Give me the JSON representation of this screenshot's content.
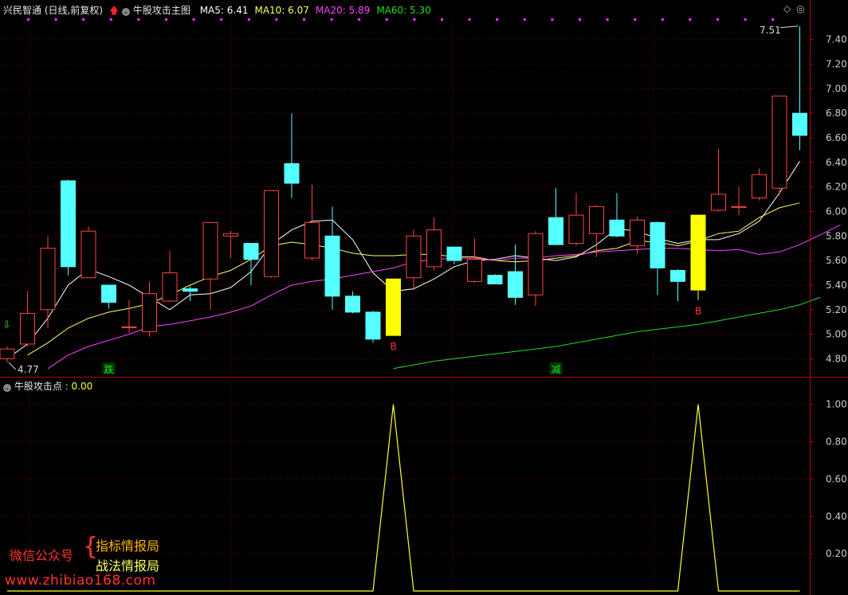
{
  "header": {
    "stock": "兴民智通",
    "period": "(日线,前复权)",
    "indicator": "牛股攻击主图",
    "ma": [
      {
        "label": "MA5:",
        "value": "6.41",
        "color": "#ffffff"
      },
      {
        "label": "MA10:",
        "value": "6.07",
        "color": "#ffff66"
      },
      {
        "label": "MA20:",
        "value": "5.89",
        "color": "#ff44ff"
      },
      {
        "label": "MA60:",
        "value": "5.30",
        "color": "#22dd22"
      }
    ]
  },
  "sub_header": {
    "label": "牛股攻击点",
    "value": ": 0.00"
  },
  "annotations": {
    "high_label": "7.51",
    "low_label": "4.77",
    "buy_label": "B",
    "mark_die": "跌",
    "mark_jian": "减"
  },
  "watermark": {
    "left": "微信公众号",
    "line1": "指标情报局",
    "line2": "战法情报局",
    "url": "www.zhibiao168.com"
  },
  "colors": {
    "up": "#ff4444",
    "down": "#55ffff",
    "signal": "#ffff00",
    "grid": "#8b0000",
    "axis_text": "#cccccc"
  },
  "chart_data": [
    {
      "type": "candlestick",
      "title": "牛股攻击主图",
      "ylim": [
        4.66,
        7.58
      ],
      "y_ticks": [
        4.8,
        5.0,
        5.2,
        5.4,
        5.6,
        5.8,
        6.0,
        6.2,
        6.4,
        6.6,
        6.8,
        7.0,
        7.2,
        7.4
      ],
      "candles": [
        {
          "o": 4.8,
          "h": 4.9,
          "l": 4.77,
          "c": 4.88
        },
        {
          "o": 4.92,
          "h": 5.35,
          "l": 4.9,
          "c": 5.17
        },
        {
          "o": 5.2,
          "h": 5.8,
          "l": 5.05,
          "c": 5.7
        },
        {
          "o": 6.25,
          "h": 6.26,
          "l": 5.48,
          "c": 5.55
        },
        {
          "o": 5.46,
          "h": 5.88,
          "l": 5.46,
          "c": 5.84
        },
        {
          "o": 5.4,
          "h": 5.4,
          "l": 5.21,
          "c": 5.26
        },
        {
          "o": 5.06,
          "h": 5.28,
          "l": 5.01,
          "c": 5.06
        },
        {
          "o": 5.02,
          "h": 5.43,
          "l": 4.98,
          "c": 5.33
        },
        {
          "o": 5.27,
          "h": 5.68,
          "l": 5.26,
          "c": 5.5
        },
        {
          "o": 5.37,
          "h": 5.39,
          "l": 5.27,
          "c": 5.35
        },
        {
          "o": 5.45,
          "h": 5.91,
          "l": 5.2,
          "c": 5.91
        },
        {
          "o": 5.8,
          "h": 5.84,
          "l": 5.62,
          "c": 5.82
        },
        {
          "o": 5.74,
          "h": 5.74,
          "l": 5.4,
          "c": 5.61
        },
        {
          "o": 5.47,
          "h": 6.17,
          "l": 5.46,
          "c": 6.17
        },
        {
          "o": 6.39,
          "h": 6.8,
          "l": 6.11,
          "c": 6.23
        },
        {
          "o": 5.62,
          "h": 6.22,
          "l": 5.6,
          "c": 5.91
        },
        {
          "o": 5.8,
          "h": 6.04,
          "l": 5.2,
          "c": 5.31
        },
        {
          "o": 5.31,
          "h": 5.35,
          "l": 5.17,
          "c": 5.18
        },
        {
          "o": 5.18,
          "h": 5.19,
          "l": 4.93,
          "c": 4.96
        },
        {
          "o": 4.99,
          "h": 5.45,
          "l": 4.99,
          "c": 5.45
        },
        {
          "o": 5.46,
          "h": 5.85,
          "l": 5.36,
          "c": 5.8
        },
        {
          "o": 5.55,
          "h": 5.95,
          "l": 5.52,
          "c": 5.85
        },
        {
          "o": 5.71,
          "h": 5.71,
          "l": 5.57,
          "c": 5.6
        },
        {
          "o": 5.43,
          "h": 5.78,
          "l": 5.42,
          "c": 5.61
        },
        {
          "o": 5.48,
          "h": 5.49,
          "l": 5.41,
          "c": 5.41
        },
        {
          "o": 5.51,
          "h": 5.73,
          "l": 5.24,
          "c": 5.3
        },
        {
          "o": 5.32,
          "h": 5.84,
          "l": 5.23,
          "c": 5.82
        },
        {
          "o": 5.95,
          "h": 6.19,
          "l": 5.73,
          "c": 5.73
        },
        {
          "o": 5.74,
          "h": 6.15,
          "l": 5.72,
          "c": 5.97
        },
        {
          "o": 5.82,
          "h": 6.05,
          "l": 5.63,
          "c": 6.04
        },
        {
          "o": 5.93,
          "h": 6.15,
          "l": 5.79,
          "c": 5.8
        },
        {
          "o": 5.72,
          "h": 5.96,
          "l": 5.65,
          "c": 5.93
        },
        {
          "o": 5.91,
          "h": 5.92,
          "l": 5.32,
          "c": 5.54
        },
        {
          "o": 5.52,
          "h": 5.53,
          "l": 5.27,
          "c": 5.43
        },
        {
          "o": 5.97,
          "h": 5.97,
          "l": 5.28,
          "c": 5.36
        },
        {
          "o": 6.01,
          "h": 6.51,
          "l": 6.0,
          "c": 6.14
        },
        {
          "o": 6.04,
          "h": 6.2,
          "l": 5.97,
          "c": 6.04
        },
        {
          "o": 6.11,
          "h": 6.35,
          "l": 6.09,
          "c": 6.3
        },
        {
          "o": 6.19,
          "h": 6.94,
          "l": 6.13,
          "c": 6.94
        },
        {
          "o": 6.8,
          "h": 7.51,
          "l": 6.5,
          "c": 6.62
        }
      ],
      "series": [
        {
          "name": "MA5",
          "color": "#ffffff",
          "start": 0,
          "values": [
            4.8,
            4.92,
            5.13,
            5.4,
            5.53,
            5.47,
            5.4,
            5.3,
            5.2,
            5.32,
            5.33,
            5.38,
            5.51,
            5.73,
            5.85,
            5.92,
            5.93,
            5.77,
            5.5,
            5.35,
            5.37,
            5.45,
            5.55,
            5.6,
            5.61,
            5.64,
            5.62,
            5.6,
            5.63,
            5.73,
            5.86,
            5.84,
            5.78,
            5.74,
            5.77,
            5.77,
            5.82,
            5.92,
            6.15,
            6.41
          ]
        },
        {
          "name": "MA10",
          "color": "#ffff66",
          "start": 1,
          "values": [
            4.83,
            4.93,
            5.05,
            5.13,
            5.18,
            5.21,
            5.25,
            5.32,
            5.4,
            5.47,
            5.52,
            5.61,
            5.72,
            5.75,
            5.73,
            5.7,
            5.66,
            5.64,
            5.64,
            5.65,
            5.65,
            5.63,
            5.63,
            5.6,
            5.59,
            5.6,
            5.62,
            5.64,
            5.68,
            5.7,
            5.76,
            5.75,
            5.72,
            5.76,
            5.82,
            5.84,
            5.95,
            6.03,
            6.07
          ]
        },
        {
          "name": "MA20",
          "color": "#ff44ff",
          "start": 2,
          "values": [
            4.72,
            4.83,
            4.9,
            4.95,
            5.0,
            5.06,
            5.08,
            5.11,
            5.14,
            5.18,
            5.23,
            5.32,
            5.4,
            5.43,
            5.45,
            5.48,
            5.51,
            5.54,
            5.59,
            5.61,
            5.62,
            5.62,
            5.6,
            5.62,
            5.62,
            5.64,
            5.65,
            5.67,
            5.68,
            5.69,
            5.7,
            5.7,
            5.69,
            5.68,
            5.69,
            5.65,
            5.67,
            5.73,
            5.81,
            5.89
          ]
        },
        {
          "name": "MA60",
          "color": "#22dd22",
          "start": 19,
          "values": [
            4.72,
            4.75,
            4.78,
            4.8,
            4.82,
            4.84,
            4.86,
            4.88,
            4.9,
            4.93,
            4.96,
            4.99,
            5.02,
            5.04,
            5.06,
            5.08,
            5.11,
            5.14,
            5.17,
            5.2,
            5.24,
            5.3
          ]
        }
      ],
      "signals": [
        19,
        34
      ],
      "markers": {
        "die": 5,
        "jian": 27
      }
    },
    {
      "type": "line",
      "title": "牛股攻击点",
      "ylim": [
        0,
        1.05
      ],
      "y_ticks": [
        0.2,
        0.4,
        0.6,
        0.8,
        1.0
      ],
      "series": [
        {
          "name": "牛股攻击点",
          "color": "#ffff33",
          "values": [
            0,
            0,
            0,
            0,
            0,
            0,
            0,
            0,
            0,
            0,
            0,
            0,
            0,
            0,
            0,
            0,
            0,
            0,
            0,
            1,
            0,
            0,
            0,
            0,
            0,
            0,
            0,
            0,
            0,
            0,
            0,
            0,
            0,
            0,
            1,
            0,
            0,
            0,
            0,
            0
          ]
        }
      ]
    }
  ]
}
